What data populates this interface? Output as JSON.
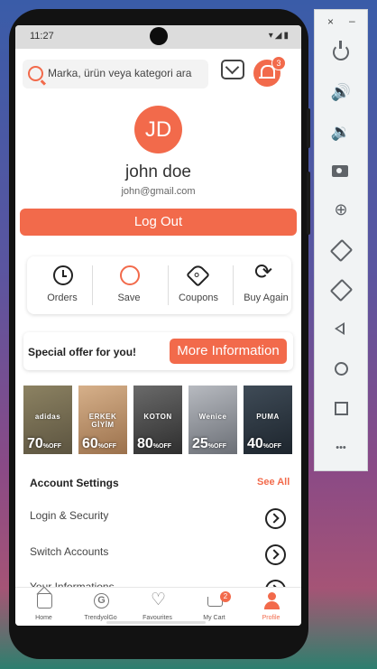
{
  "status": {
    "time": "11:27",
    "icons": "▾◢▮"
  },
  "search": {
    "placeholder": "Marka, ürün veya kategori ara",
    "notification_count": "3"
  },
  "profile": {
    "initials": "JD",
    "name": "john doe",
    "email": "john@gmail.com",
    "logout_label": "Log Out"
  },
  "quick_actions": [
    {
      "label": "Orders",
      "icon": "clock-icon"
    },
    {
      "label": "Save",
      "icon": "save-icon"
    },
    {
      "label": "Coupons",
      "icon": "coupon-icon"
    },
    {
      "label": "Buy Again",
      "icon": "refresh-icon"
    }
  ],
  "offer": {
    "text": "Special offer for you!",
    "button_label": "More Information"
  },
  "brands": [
    {
      "name": "adidas",
      "discount": "70",
      "unit": "%OFF",
      "color": "#7a6f52"
    },
    {
      "name": "ERKEK GİYİM",
      "discount": "60",
      "unit": "%OFF",
      "color": "#b58a5f"
    },
    {
      "name": "KOTON",
      "discount": "80",
      "unit": "%OFF",
      "color": "#4a4a4a"
    },
    {
      "name": "Wenice",
      "discount": "25",
      "unit": "%OFF",
      "color": "#8c8f94"
    },
    {
      "name": "PUMA",
      "discount": "40",
      "unit": "%OFF",
      "color": "#2f3a44"
    }
  ],
  "account": {
    "title": "Account Settings",
    "see_all": "See All",
    "items": [
      {
        "label": "Login & Security"
      },
      {
        "label": "Switch Accounts"
      },
      {
        "label": "Your Informations"
      }
    ]
  },
  "bottom_nav": [
    {
      "label": "Home",
      "icon": "home-icon"
    },
    {
      "label": "TrendyolGo",
      "icon": "go-icon"
    },
    {
      "label": "Favourites",
      "icon": "heart-icon"
    },
    {
      "label": "My Cart",
      "icon": "cart-icon",
      "badge": "2"
    },
    {
      "label": "Profile",
      "icon": "profile-icon",
      "active": true
    }
  ],
  "colors": {
    "accent": "#f26a4b",
    "text": "#222222",
    "muted": "#555555"
  },
  "emulator": {
    "close_glyph": "×",
    "min_glyph": "–",
    "more_glyph": "•••"
  }
}
